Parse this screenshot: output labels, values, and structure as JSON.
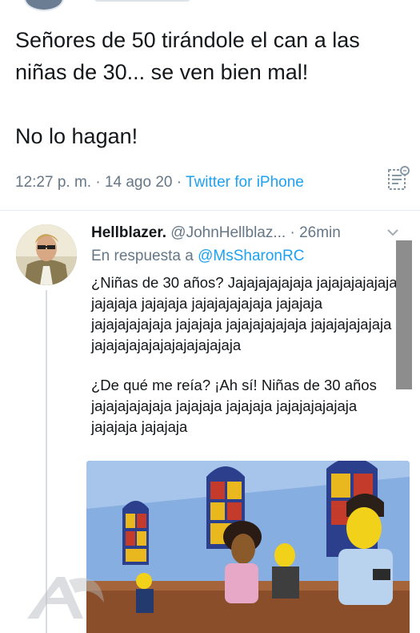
{
  "tweet": {
    "text": "Señores de 50 tirándole el can a las niñas de 30... se ven bien mal!\n\nNo lo hagan!",
    "time": "12:27 p. m.",
    "date": "14 ago 20",
    "source": "Twitter for iPhone",
    "sep": " · "
  },
  "reply": {
    "name": "Hellblazer.",
    "handle": "@JohnHellblaz...",
    "age": "26min",
    "reply_prefix": "En respuesta a",
    "reply_handle": "@MsSharonRC",
    "paragraph1": "¿Niñas de 30 años? Jajajajajajaja jajajajajajaja jajajaja jajajaja jajajajajajaja jajajaja jajajajajajaja jajajaja jajajajajajaja jajajajajajaja jajajajajajajajajajajajaja",
    "paragraph2": "¿De qué me reía? ¡Ah sí! Niñas de 30 años jajajajajajaja jajajaja jajajaja jajajajajajaja jajajaja jajajaja"
  },
  "icons": {
    "analytics": "analytics-icon",
    "chevron": "chevron-down-icon"
  },
  "colors": {
    "link": "#1da1f2",
    "muted": "#657786",
    "text": "#14171a"
  }
}
